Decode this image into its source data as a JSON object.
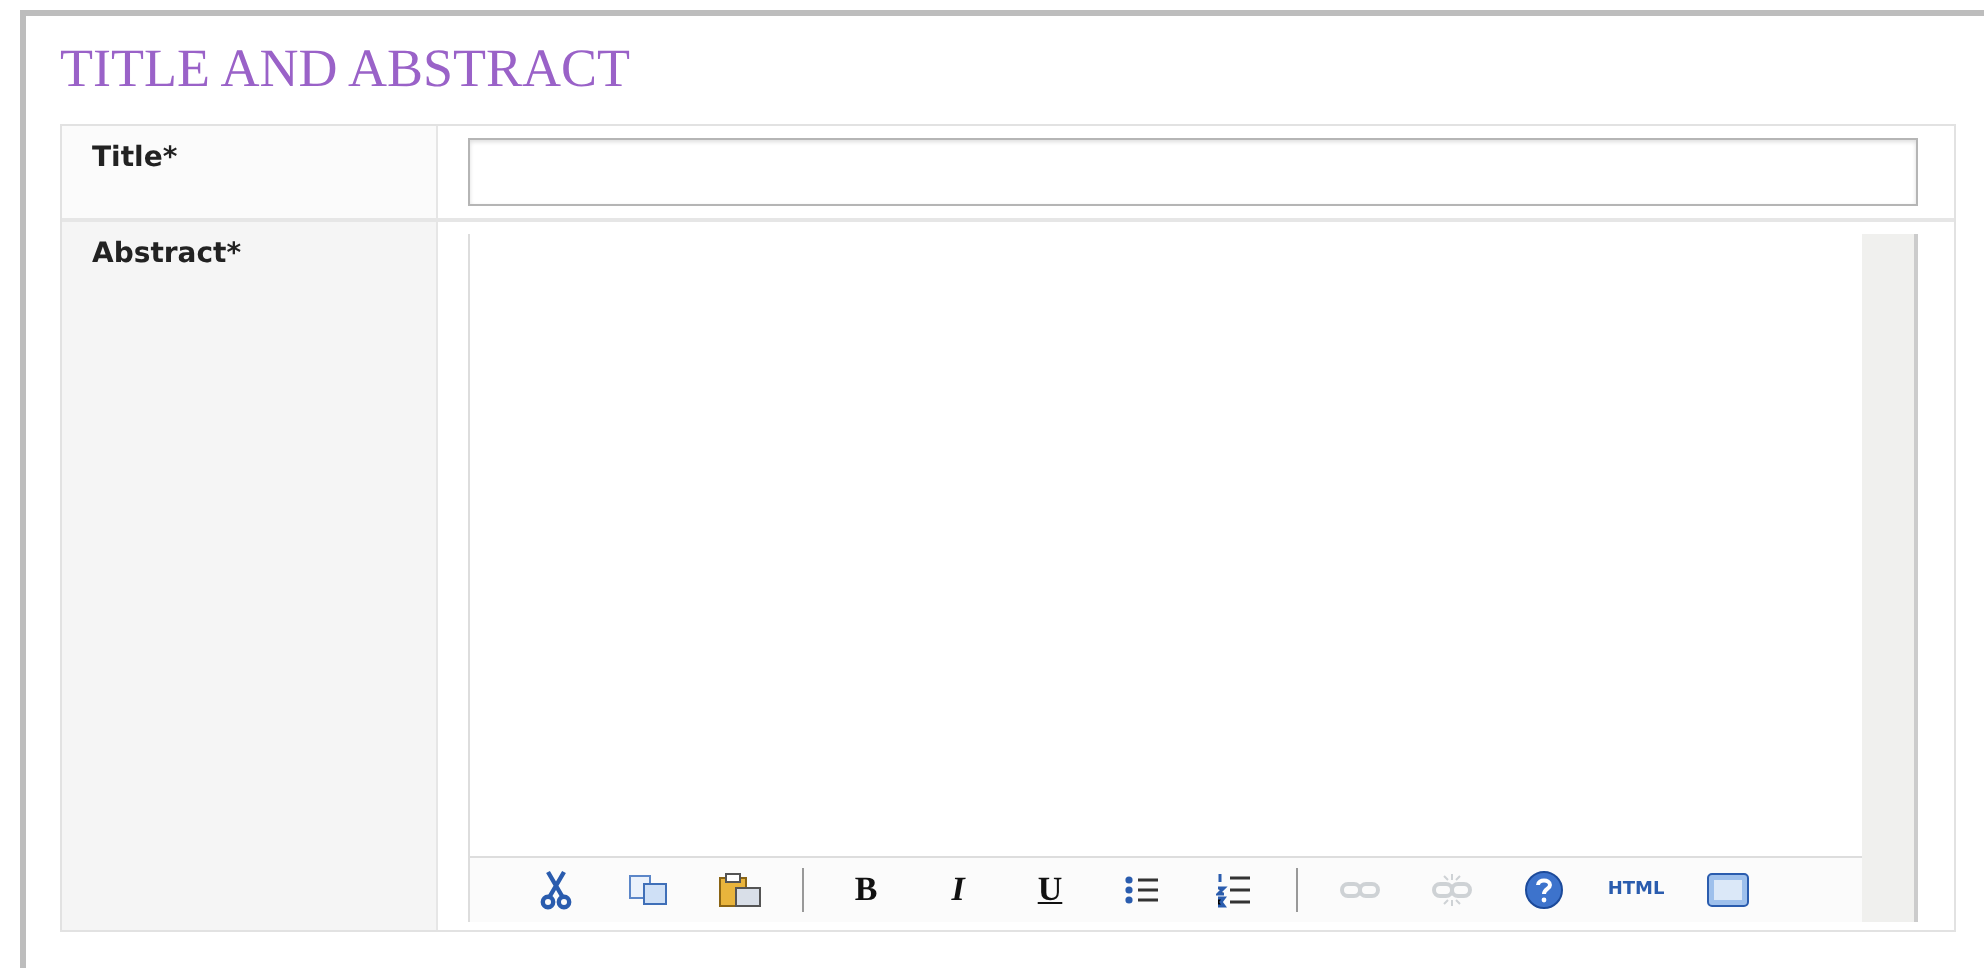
{
  "section_title": "TITLE AND ABSTRACT",
  "fields": [
    {
      "label": "Title*",
      "kind": "input"
    },
    {
      "label": "Abstract*",
      "kind": "editor"
    }
  ],
  "toolbar": [
    {
      "kind": "cut",
      "disabled": false
    },
    {
      "kind": "copy",
      "disabled": false
    },
    {
      "kind": "paste",
      "disabled": false
    },
    {
      "kind": "separator"
    },
    {
      "kind": "bold",
      "label": "B",
      "disabled": false
    },
    {
      "kind": "italic",
      "label": "I",
      "disabled": false
    },
    {
      "kind": "underline",
      "label": "U",
      "disabled": false
    },
    {
      "kind": "bullets",
      "disabled": false
    },
    {
      "kind": "numbers",
      "disabled": false
    },
    {
      "kind": "separator"
    },
    {
      "kind": "link",
      "disabled": true
    },
    {
      "kind": "unlink",
      "disabled": true
    },
    {
      "kind": "help",
      "disabled": false
    },
    {
      "kind": "html",
      "label": "HTML",
      "disabled": false
    },
    {
      "kind": "window",
      "disabled": false
    }
  ]
}
